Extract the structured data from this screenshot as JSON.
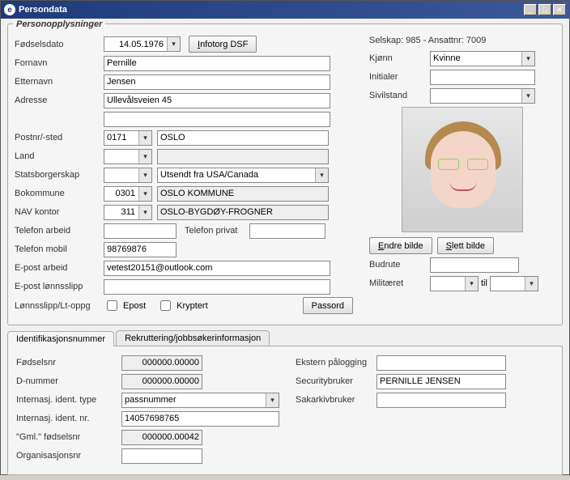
{
  "window": {
    "title": "Persondata"
  },
  "group_title": "Personopplysninger",
  "labels": {
    "fodselsdato": "Fødselsdato",
    "fornavn": "Fornavn",
    "etternavn": "Etternavn",
    "adresse": "Adresse",
    "postnr": "Postnr/-sted",
    "land": "Land",
    "statsborgerskap": "Statsborgerskap",
    "bokommune": "Bokommune",
    "navkontor": "NAV kontor",
    "tlf_arbeid": "Telefon arbeid",
    "tlf_privat": "Telefon privat",
    "tlf_mobil": "Telefon mobil",
    "epost_arbeid": "E-post arbeid",
    "epost_lonn": "E-post lønnsslipp",
    "lonnslipp": "Lønnsslipp/Lt-oppg",
    "epost_chk": "Epost",
    "kryptert_chk": "Kryptert",
    "passord_btn": "Passord",
    "infotorg_btn": "Infotorg DSF",
    "selskap_info": "Selskap: 985 - Ansattnr:  7009",
    "kjonn": "Kjønn",
    "initialer": "Initialer",
    "sivilstand": "Sivilstand",
    "endre_bilde": "Endre bilde",
    "slett_bilde": "Slett bilde",
    "budrute": "Budrute",
    "militaret": "Militæret",
    "til": "til"
  },
  "values": {
    "fodselsdato": "14.05.1976",
    "fornavn": "Pernille",
    "etternavn": "Jensen",
    "adresse": "Ullevålsveien 45",
    "adresse2": "",
    "postnr": "0171",
    "poststed": "OSLO",
    "land": "",
    "land_navn": "",
    "statsborgerskap": "",
    "statsborgerskap_txt": "Utsendt fra USA/Canada",
    "bokommune": "0301",
    "bokommune_navn": "OSLO KOMMUNE",
    "navkontor": "311",
    "navkontor_navn": "OSLO-BYGDØY-FROGNER",
    "tlf_arbeid": "",
    "tlf_privat": "",
    "tlf_mobil": "98769876",
    "epost_arbeid": "vetest20151@outlook.com",
    "epost_lonn": "",
    "kjonn": "Kvinne",
    "initialer": "",
    "sivilstand": "",
    "budrute": "",
    "militar_fra": "",
    "militar_til": ""
  },
  "tabs": {
    "tab1": "Identifikasjonsnummer",
    "tab2": "Rekruttering/jobbsøkerinformasjon"
  },
  "tab1_labels": {
    "fodselsnr": "Fødselsnr",
    "dnummer": "D-nummer",
    "ident_type": "Internasj. ident. type",
    "ident_nr": "Internasj. ident. nr.",
    "gml_fodselsnr": "\"Gml.\" fødselsnr",
    "orgnr": "Organisasjonsnr",
    "ekstern": "Ekstern pålogging",
    "security": "Securitybruker",
    "sakarkiv": "Sakarkivbruker"
  },
  "tab1_values": {
    "fodselsnr": "000000.00000",
    "dnummer": "000000.00000",
    "ident_type": "passnummer",
    "ident_nr": "14057698765",
    "gml_fodselsnr": "000000.00042",
    "orgnr": "",
    "ekstern": "",
    "security": "PERNILLE JENSEN",
    "sakarkiv": ""
  }
}
